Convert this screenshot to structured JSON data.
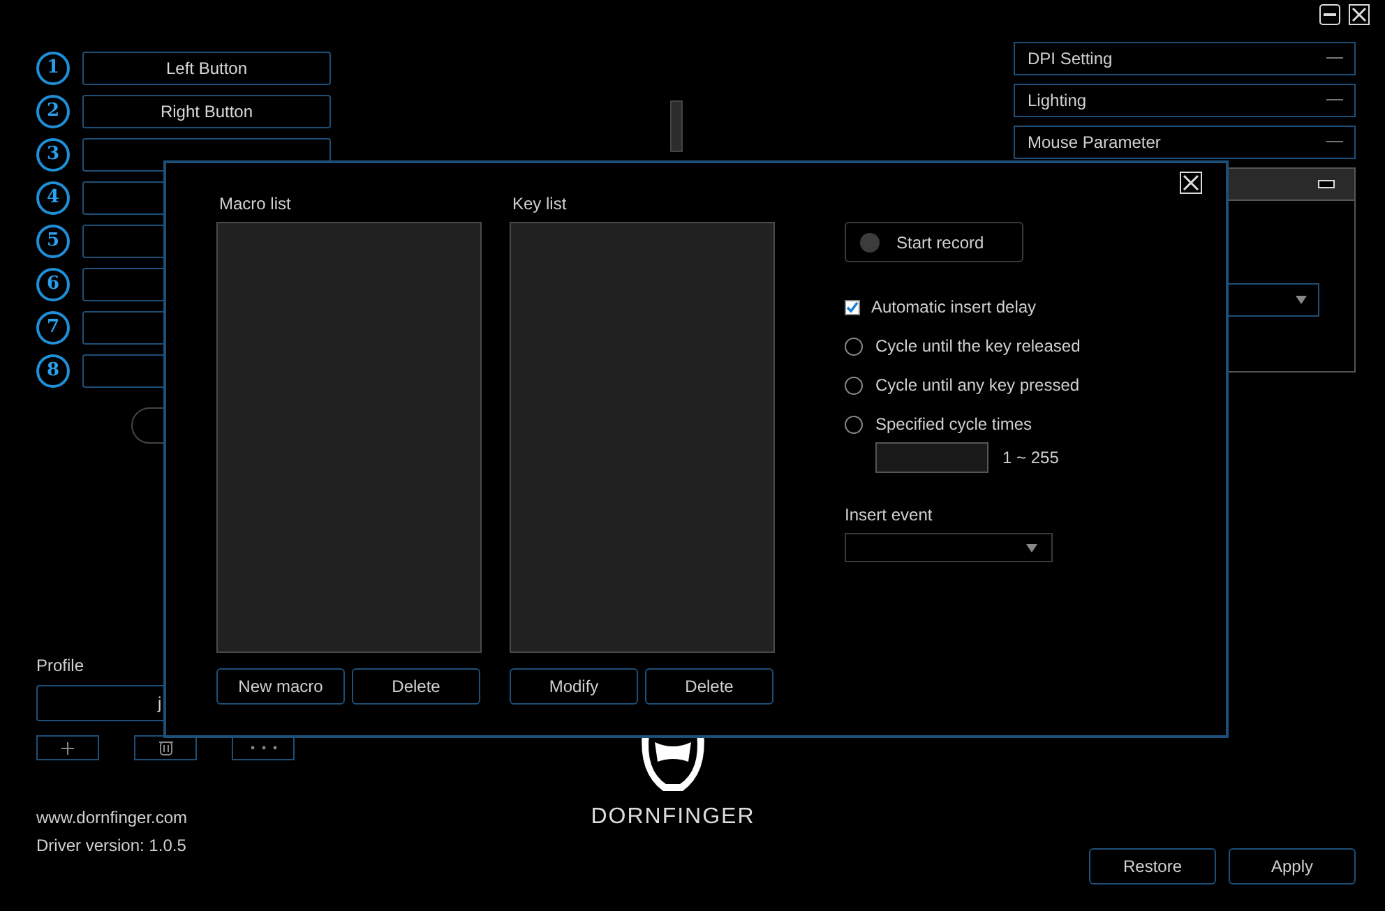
{
  "button_slots": [
    {
      "number": "1",
      "label": "Left Button"
    },
    {
      "number": "2",
      "label": "Right Button"
    },
    {
      "number": "3"
    },
    {
      "number": "4"
    },
    {
      "number": "5"
    },
    {
      "number": "6"
    },
    {
      "number": "7"
    },
    {
      "number": "8"
    }
  ],
  "settings_panels": [
    {
      "title": "DPI Setting",
      "expanded": false
    },
    {
      "title": "Lighting",
      "expanded": false
    },
    {
      "title": "Mouse Parameter",
      "expanded": false
    },
    {
      "expanded": true
    }
  ],
  "profile": {
    "label": "Profile",
    "value": "j"
  },
  "footer": {
    "website": "www.dornfinger.com",
    "driver_version": "Driver version: 1.0.5"
  },
  "brand": "DORNFINGER",
  "buttons": [
    "Restore",
    "Apply"
  ],
  "macro_dialog": {
    "macro_list": {
      "label": "Macro list",
      "buttons": [
        "New macro",
        "Delete"
      ]
    },
    "key_list": {
      "label": "Key list",
      "buttons": [
        "Modify",
        "Delete"
      ]
    },
    "record_button": "Start record",
    "auto_delay": {
      "label": "Automatic insert delay",
      "checked": true
    },
    "cycle_options": [
      {
        "label": "Cycle until the key released",
        "selected": false
      },
      {
        "label": "Cycle until any key pressed",
        "selected": false
      },
      {
        "label": "Specified cycle times",
        "selected": false
      }
    ],
    "cycle_range": "1 ~ 255",
    "insert_event": {
      "label": "Insert event"
    }
  }
}
